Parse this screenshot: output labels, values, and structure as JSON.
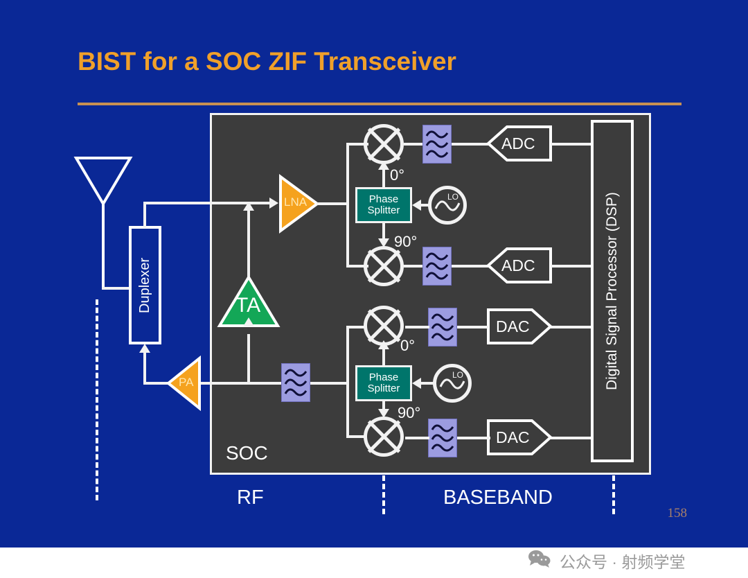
{
  "slide": {
    "title": "BIST for a SOC ZIF Transceiver",
    "page_number": "158",
    "background_color": "#0A2896",
    "title_color": "#F0A02A",
    "rule_color": "#C89152"
  },
  "diagram": {
    "soc": {
      "label": "SOC",
      "fill_color": "#3C3C3C",
      "border_color": "#F2F2F2"
    },
    "antenna": {
      "name": "antenna"
    },
    "duplexer": {
      "label": "Duplexer"
    },
    "amplifiers": [
      {
        "label": "LNA",
        "color": "#F5A21E",
        "orientation": "right"
      },
      {
        "label": "TA",
        "color": "#13A757",
        "orientation": "up"
      },
      {
        "label": "PA",
        "color": "#F5A21E",
        "orientation": "left"
      }
    ],
    "phase_splitters": [
      {
        "label_line1": "Phase",
        "label_line2": "Splitter",
        "color": "#00756B"
      },
      {
        "label_line1": "Phase",
        "label_line2": "Splitter",
        "color": "#00756B"
      }
    ],
    "oscillators": [
      {
        "label": "LO"
      },
      {
        "label": "LO"
      }
    ],
    "phase_labels": {
      "zero": "0°",
      "ninety": "90°"
    },
    "converters": [
      {
        "label": "ADC",
        "direction": "left",
        "chain": "receive-i"
      },
      {
        "label": "ADC",
        "direction": "left",
        "chain": "receive-q"
      },
      {
        "label": "DAC",
        "direction": "right",
        "chain": "transmit-i"
      },
      {
        "label": "DAC",
        "direction": "right",
        "chain": "transmit-q"
      }
    ],
    "dsp": {
      "label": "Digital Signal Processor (DSP)"
    },
    "filters": {
      "count": 5,
      "color": "#9C9CE0",
      "wave_color": "#101038"
    },
    "mixers": {
      "count": 4,
      "color": "#F2F2F2"
    },
    "section_labels": {
      "rf": "RF",
      "baseband": "BASEBAND"
    }
  },
  "watermark": {
    "text": "公众号 · 射频学堂",
    "icon": "wechat-icon"
  }
}
